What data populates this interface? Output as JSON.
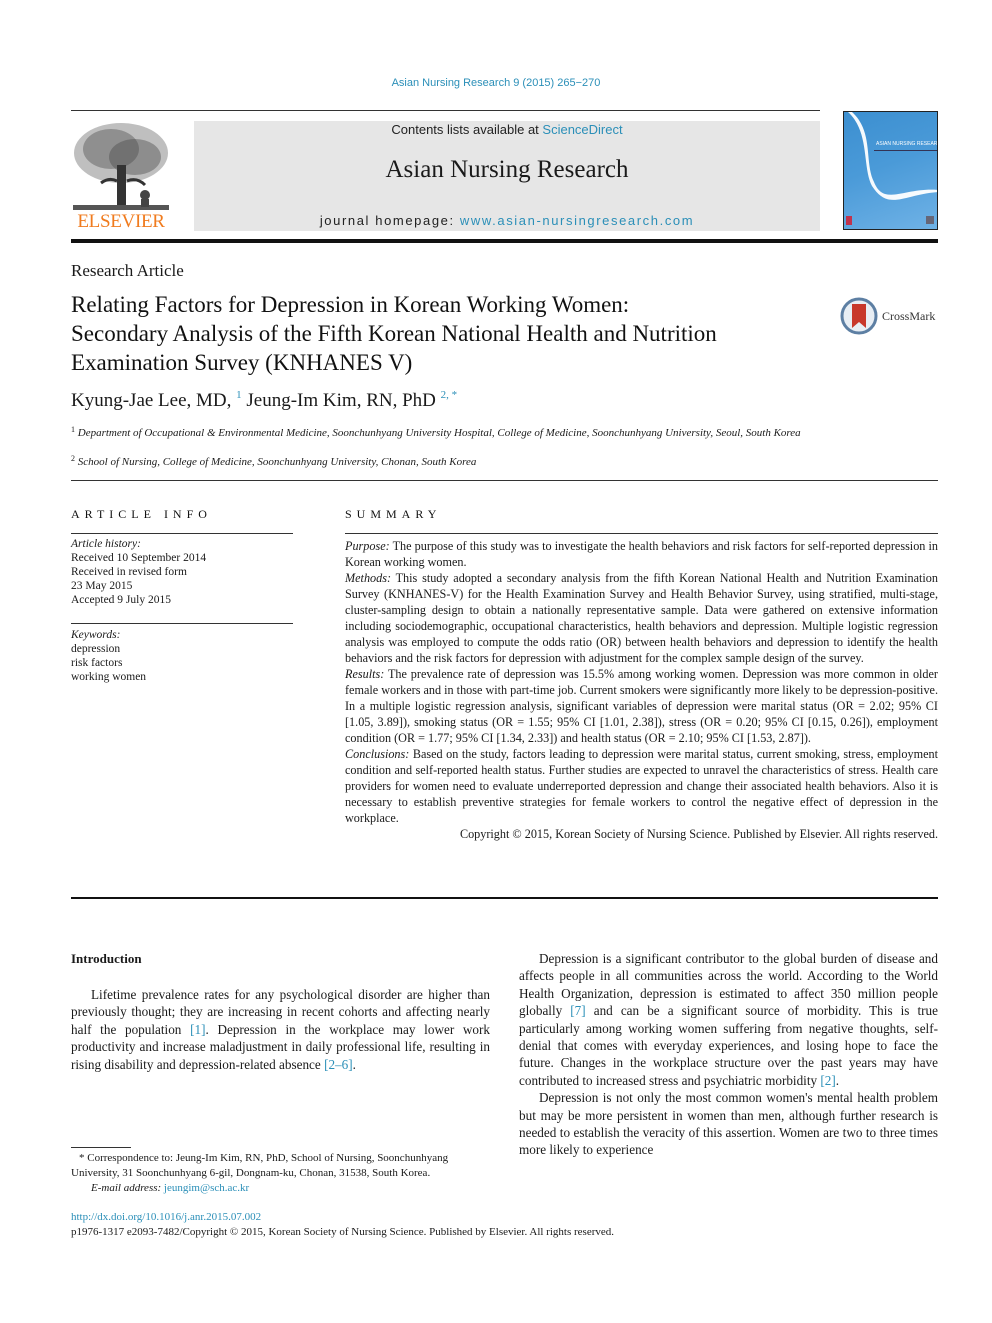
{
  "journal_citation": "Asian Nursing Research 9 (2015) 265−270",
  "masthead": {
    "publisher_logo_text": "ELSEVIER",
    "contents_prefix": "Contents lists available at ",
    "contents_link": "ScienceDirect",
    "journal_title": "Asian Nursing Research",
    "homepage_prefix": "journal homepage: ",
    "homepage_link": "www.asian-nursingresearch.com",
    "cover_title": "ASIAN NURSING RESEARCH"
  },
  "article": {
    "type": "Research Article",
    "title_lines": [
      "Relating Factors for Depression in Korean Working Women:",
      "Secondary Analysis of the Fifth Korean National Health and Nutrition",
      "Examination Survey (KNHANES V)"
    ],
    "crossmark_label": "CrossMark",
    "authors": [
      {
        "name": "Kyung-Jae Lee, MD,",
        "sup": "1"
      },
      {
        "name": "Jeung-Im Kim, RN, PhD",
        "sup": "2, *"
      }
    ],
    "affiliations": [
      {
        "sup": "1",
        "text": "Department of Occupational & Environmental Medicine, Soonchunhyang University Hospital, College of Medicine, Soonchunhyang University, Seoul, South Korea"
      },
      {
        "sup": "2",
        "text": "School of Nursing, College of Medicine, Soonchunhyang University, Chonan, South Korea"
      }
    ]
  },
  "article_info": {
    "heading": "ARTICLE INFO",
    "history_label": "Article history:",
    "history": [
      "Received 10 September 2014",
      "Received in revised form",
      "23 May 2015",
      "Accepted 9 July 2015"
    ],
    "keywords_label": "Keywords:",
    "keywords": [
      "depression",
      "risk factors",
      "working women"
    ]
  },
  "summary": {
    "heading": "SUMMARY",
    "sections": [
      {
        "label": "Purpose:",
        "text": " The purpose of this study was to investigate the health behaviors and risk factors for self-reported depression in Korean working women."
      },
      {
        "label": "Methods:",
        "text": " This study adopted a secondary analysis from the fifth Korean National Health and Nutrition Examination Survey (KNHANES-V) for the Health Examination Survey and Health Behavior Survey, using stratified, multi-stage, cluster-sampling design to obtain a nationally representative sample. Data were gathered on extensive information including sociodemographic, occupational characteristics, health behaviors and depression. Multiple logistic regression analysis was employed to compute the odds ratio (OR) between health behaviors and depression to identify the health behaviors and the risk factors for depression with adjustment for the complex sample design of the survey."
      },
      {
        "label": "Results:",
        "text": " The prevalence rate of depression was 15.5% among working women. Depression was more common in older female workers and in those with part-time job. Current smokers were significantly more likely to be depression-positive. In a multiple logistic regression analysis, significant variables of depression were marital status (OR = 2.02; 95% CI [1.05, 3.89]), smoking status (OR = 1.55; 95% CI [1.01, 2.38]), stress (OR = 0.20; 95% CI [0.15, 0.26]), employment condition (OR = 1.77; 95% CI [1.34, 2.33]) and health status (OR = 2.10; 95% CI [1.53, 2.87])."
      },
      {
        "label": "Conclusions:",
        "text": " Based on the study, factors leading to depression were marital status, current smoking, stress, employment condition and self-reported health status. Further studies are expected to unravel the characteristics of stress. Health care providers for women need to evaluate underreported depression and change their associated health behaviors. Also it is necessary to establish preventive strategies for female workers to control the negative effect of depression in the workplace."
      }
    ],
    "copyright": "Copyright © 2015, Korean Society of Nursing Science. Published by Elsevier. All rights reserved."
  },
  "introduction": {
    "heading": "Introduction",
    "left_para": {
      "t1": "Lifetime prevalence rates for any psychological disorder are higher than previously thought; they are increasing in recent cohorts and affecting nearly half the population ",
      "ref1": "[1]",
      "t2": ". Depression in the workplace may lower work productivity and increase maladjustment in daily professional life, resulting in rising disability and depression-related absence ",
      "ref2": "[2–6]",
      "t3": "."
    },
    "right_para1": {
      "t1": "Depression is a significant contributor to the global burden of disease and affects people in all communities across the world. According to the World Health Organization, depression is estimated to affect 350 million people globally ",
      "ref1": "[7]",
      "t2": " and can be a significant source of morbidity. This is true particularly among working women suffering from negative thoughts, self-denial that comes with everyday experiences, and losing hope to face the future. Changes in the workplace structure over the past years may have contributed to increased stress and psychiatric morbidity ",
      "ref2": "[2]",
      "t3": "."
    },
    "right_para2": "Depression is not only the most common women's mental health problem but may be more persistent in women than men, although further research is needed to establish the veracity of this assertion. Women are two to three times more likely to experience"
  },
  "footnote": {
    "correspondence": "* Correspondence to: Jeung-Im Kim, RN, PhD, School of Nursing, Soonchunhyang University, 31 Soonchunhyang 6-gil, Dongnam-ku, Chonan, 31538, South Korea.",
    "email_label": "E-mail address:",
    "email": "jeungim@sch.ac.kr"
  },
  "doi": "http://dx.doi.org/10.1016/j.anr.2015.07.002",
  "issn_copyright": "p1976-1317 e2093-7482/Copyright © 2015, Korean Society of Nursing Science. Published by Elsevier. All rights reserved.",
  "colors": {
    "link": "#2b8fb8",
    "elsevier_orange": "#f07b1e",
    "banner_bg": "#e6e6e6"
  }
}
